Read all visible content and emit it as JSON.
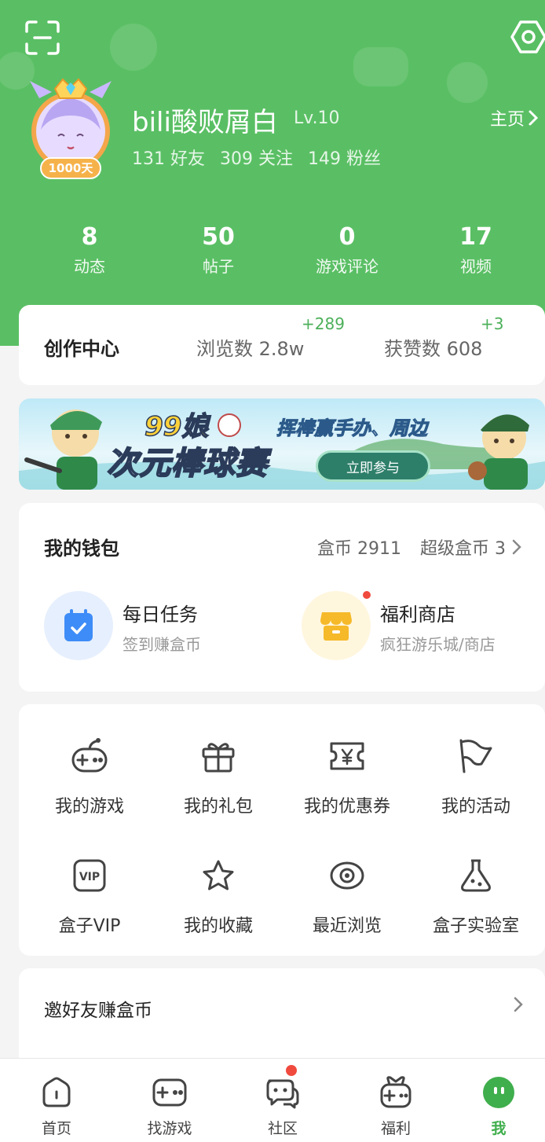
{
  "colors": {
    "primary_green": "#5abf64",
    "delta_green": "#4cb05a",
    "badge_red": "#f04a3e"
  },
  "top_icons": {
    "scan": "scan-icon",
    "settings": "settings-icon"
  },
  "profile": {
    "avatar_badge": "1000天",
    "username": "bili酸败屑白",
    "level": "Lv.10",
    "homepage_label": "主页",
    "friends": "131 好友",
    "following": "309 关注",
    "fans": "149 粉丝"
  },
  "stats": [
    {
      "value": "8",
      "label": "动态"
    },
    {
      "value": "50",
      "label": "帖子"
    },
    {
      "value": "0",
      "label": "游戏评论"
    },
    {
      "value": "17",
      "label": "视频"
    }
  ],
  "creator": {
    "title": "创作中心",
    "views_label": "浏览数 2.8w",
    "views_delta": "+289",
    "likes_label": "获赞数 608",
    "likes_delta": "+3"
  },
  "banner": {
    "title_top": "99娘",
    "title_main": "次元棒球赛",
    "subtitle": "挥棒赢手办、周边",
    "button": "立即参与"
  },
  "wallet": {
    "title": "我的钱包",
    "coins": "盒币 2911",
    "super_coins": "超级盒币 3",
    "daily_task": {
      "title": "每日任务",
      "sub": "签到赚盒币"
    },
    "shop": {
      "title": "福利商店",
      "sub": "疯狂游乐城/商店"
    }
  },
  "grid": [
    {
      "label": "我的游戏",
      "icon": "gamepad-icon"
    },
    {
      "label": "我的礼包",
      "icon": "gift-icon"
    },
    {
      "label": "我的优惠券",
      "icon": "coupon-icon"
    },
    {
      "label": "我的活动",
      "icon": "flag-icon"
    },
    {
      "label": "盒子VIP",
      "icon": "vip-icon"
    },
    {
      "label": "我的收藏",
      "icon": "star-icon"
    },
    {
      "label": "最近浏览",
      "icon": "eye-icon"
    },
    {
      "label": "盒子实验室",
      "icon": "flask-icon"
    }
  ],
  "invite": {
    "label": "邀好友赚盒币"
  },
  "tabbar": [
    {
      "label": "首页",
      "icon": "home-icon"
    },
    {
      "label": "找游戏",
      "icon": "gamepad-icon"
    },
    {
      "label": "社区",
      "icon": "chat-icon"
    },
    {
      "label": "福利",
      "icon": "gift-box-icon"
    },
    {
      "label": "我",
      "icon": "me-icon"
    }
  ]
}
